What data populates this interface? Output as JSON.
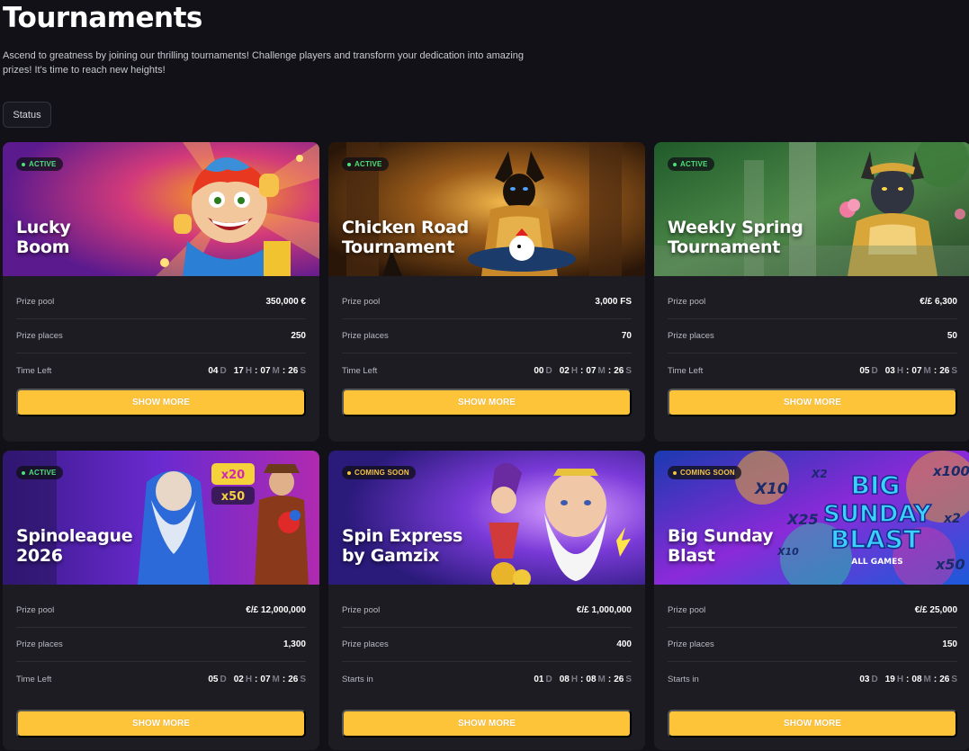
{
  "header": {
    "title": "Tournaments",
    "description": "Ascend to greatness by joining our thrilling tournaments! Challenge players and transform your dedication into amazing prizes! It's time to reach new heights!",
    "status_button": "Status"
  },
  "colors": {
    "background": "#111117",
    "card": "#1c1c22",
    "accent": "#fdc43a",
    "active": "#4ce07a",
    "coming_soon": "#f5c542"
  },
  "units": {
    "d": "D",
    "h": "H",
    "m": "M",
    "s": "S"
  },
  "cards": [
    {
      "status": "ACTIVE",
      "title_line1": "Lucky",
      "title_line2": "Boom",
      "prize_pool_label": "Prize pool",
      "prize_pool": "350,000 €",
      "prize_places_label": "Prize places",
      "prize_places": "250",
      "time_label": "Time Left",
      "days": "04",
      "hours": "17",
      "minutes": "07",
      "seconds": "26",
      "button": "SHOW MORE",
      "banner_icon": "jester-character-image"
    },
    {
      "status": "ACTIVE",
      "title_line1": "Chicken Road",
      "title_line2": "Tournament",
      "prize_pool_label": "Prize pool",
      "prize_pool": "3,000 FS",
      "prize_places_label": "Prize places",
      "prize_places": "70",
      "time_label": "Time Left",
      "days": "00",
      "hours": "02",
      "minutes": "07",
      "seconds": "26",
      "button": "SHOW MORE",
      "banner_icon": "anubis-warrior-image"
    },
    {
      "status": "ACTIVE",
      "title_line1": "Weekly Spring",
      "title_line2": "Tournament",
      "prize_pool_label": "Prize pool",
      "prize_pool": "€/£ 6,300",
      "prize_places_label": "Prize places",
      "prize_places": "50",
      "time_label": "Time Left",
      "days": "05",
      "hours": "03",
      "minutes": "07",
      "seconds": "26",
      "button": "SHOW MORE",
      "banner_icon": "bastet-goddess-image"
    },
    {
      "status": "ACTIVE",
      "title_line1": "Spinoleague",
      "title_line2": "2026",
      "prize_pool_label": "Prize pool",
      "prize_pool": "€/£ 12,000,000",
      "prize_places_label": "Prize places",
      "prize_places": "1,300",
      "time_label": "Time Left",
      "days": "05",
      "hours": "02",
      "minutes": "07",
      "seconds": "26",
      "button": "SHOW MORE",
      "banner_icon": "zeus-and-explorer-image"
    },
    {
      "status": "COMING SOON",
      "title_line1": "Spin Express",
      "title_line2": "by Gamzix",
      "prize_pool_label": "Prize pool",
      "prize_pool": "€/£ 1,000,000",
      "prize_places_label": "Prize places",
      "prize_places": "400",
      "time_label": "Starts in",
      "days": "01",
      "hours": "08",
      "minutes": "08",
      "seconds": "26",
      "button": "SHOW MORE",
      "banner_icon": "zeus-and-jester-image"
    },
    {
      "status": "COMING SOON",
      "title_line1": "Big Sunday",
      "title_line2": "Blast",
      "prize_pool_label": "Prize pool",
      "prize_pool": "€/£ 25,000",
      "prize_places_label": "Prize places",
      "prize_places": "150",
      "time_label": "Starts in",
      "days": "03",
      "hours": "19",
      "minutes": "08",
      "seconds": "26",
      "button": "SHOW MORE",
      "banner_icon": "big-sunday-blast-logo",
      "banner_text": {
        "line1": "BIG",
        "line2": "SUNDAY",
        "line3": "BLAST",
        "sub": "ALL GAMES",
        "m1": "X10",
        "m2": "X2",
        "m3": "X25",
        "m4": "x100",
        "m5": "X10",
        "m6": "x2",
        "m7": "x50"
      }
    }
  ]
}
